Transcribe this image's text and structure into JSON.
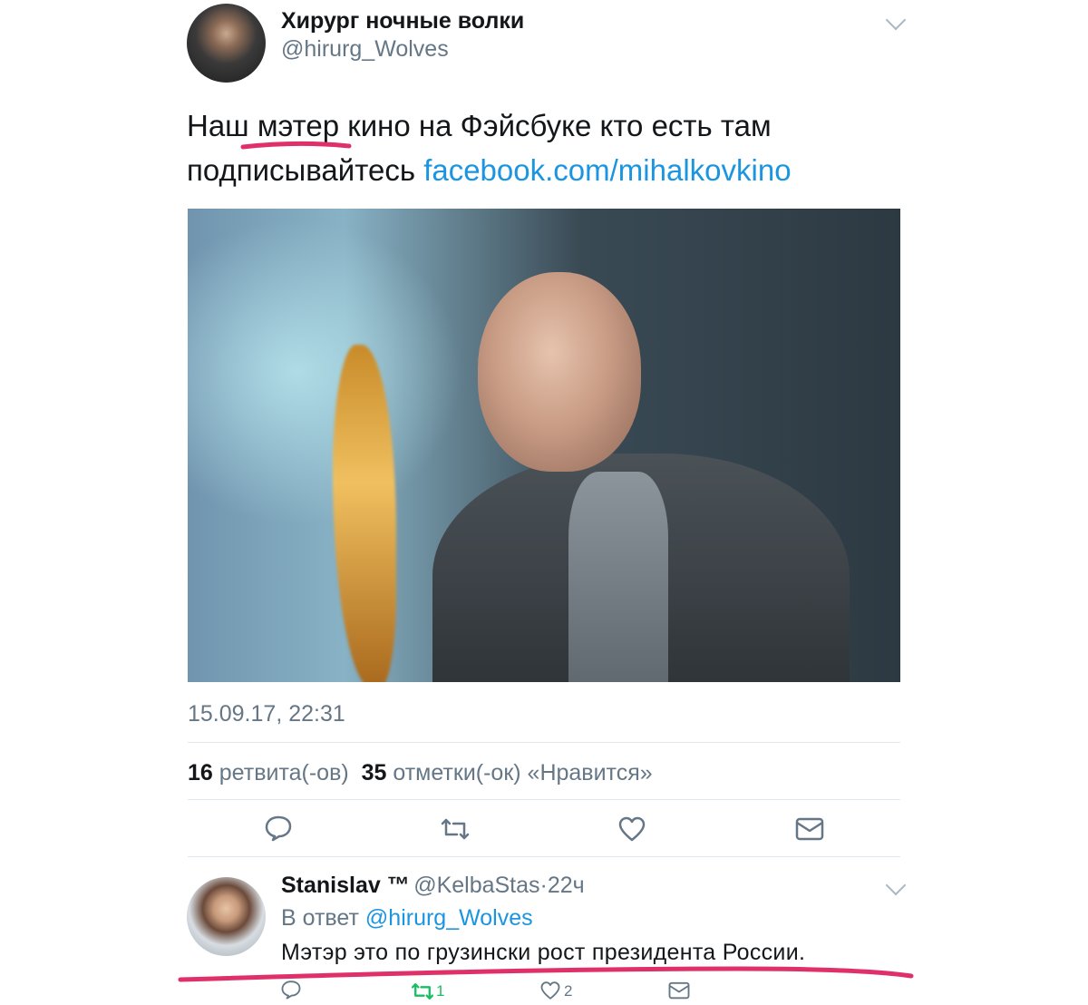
{
  "tweet": {
    "author_name": "Хирург ночные волки",
    "author_handle": "@hirurg_Wolves",
    "text_part1": "Наш",
    "text_highlight": "мэтер",
    "text_part2": "кино на Фэйсбуке кто есть там",
    "text_line2": "подписывайтесь",
    "link": "facebook.com/mihalkovkino",
    "timestamp": "15.09.17, 22:31",
    "retweets_count": "16",
    "retweets_label": "ретвита(-ов)",
    "likes_count": "35",
    "likes_label": "отметки(-ок) «Нравится»"
  },
  "actions": {
    "reply_icon": "reply-icon",
    "retweet_icon": "retweet-icon",
    "like_icon": "heart-icon",
    "dm_icon": "envelope-icon"
  },
  "reply": {
    "author_name": "Stanislav ™",
    "author_handle": "@KelbaStas",
    "separator": "·",
    "time": "22ч",
    "in_reply_prefix": "В ответ",
    "in_reply_handle": "@hirurg_Wolves",
    "text": "Мэтэр это по грузински рост президента России.",
    "retweet_count": "1",
    "like_count": "2"
  },
  "colors": {
    "link": "#1b95e0",
    "annotation_underline": "#e0306a",
    "retweet_active": "#17bf63",
    "muted": "#657786"
  }
}
